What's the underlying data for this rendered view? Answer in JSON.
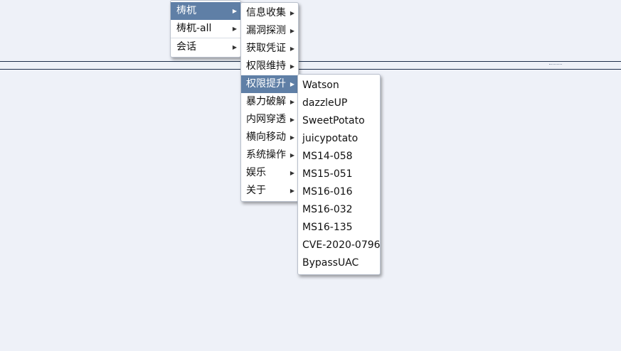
{
  "main_menu": {
    "items": [
      {
        "label": "梼杌",
        "selected": true
      },
      {
        "label": "梼杌-all",
        "selected": false
      },
      {
        "label": "会话",
        "selected": false
      }
    ]
  },
  "sub_menu": {
    "items": [
      {
        "label": "信息收集"
      },
      {
        "label": "漏洞探测"
      },
      {
        "label": "获取凭证"
      },
      {
        "label": "权限维持"
      },
      {
        "label": "权限提升",
        "selected": true
      },
      {
        "label": "暴力破解"
      },
      {
        "label": "内网穿透"
      },
      {
        "label": "横向移动"
      },
      {
        "label": "系统操作"
      },
      {
        "label": "娱乐"
      },
      {
        "label": "关于"
      }
    ]
  },
  "privilege_menu": {
    "items": [
      "Watson",
      "dazzleUP",
      "SweetPotato",
      "juicypotato",
      "MS14-058",
      "MS15-051",
      "MS16-016",
      "MS16-032",
      "MS16-135",
      "CVE-2020-0796",
      "BypassUAC"
    ]
  },
  "icons": {
    "submenu_arrow": "chevron-right-icon"
  },
  "colors": {
    "background": "#eef1f8",
    "selected": "#5f7fa6",
    "divider": "#1e2e4a"
  }
}
